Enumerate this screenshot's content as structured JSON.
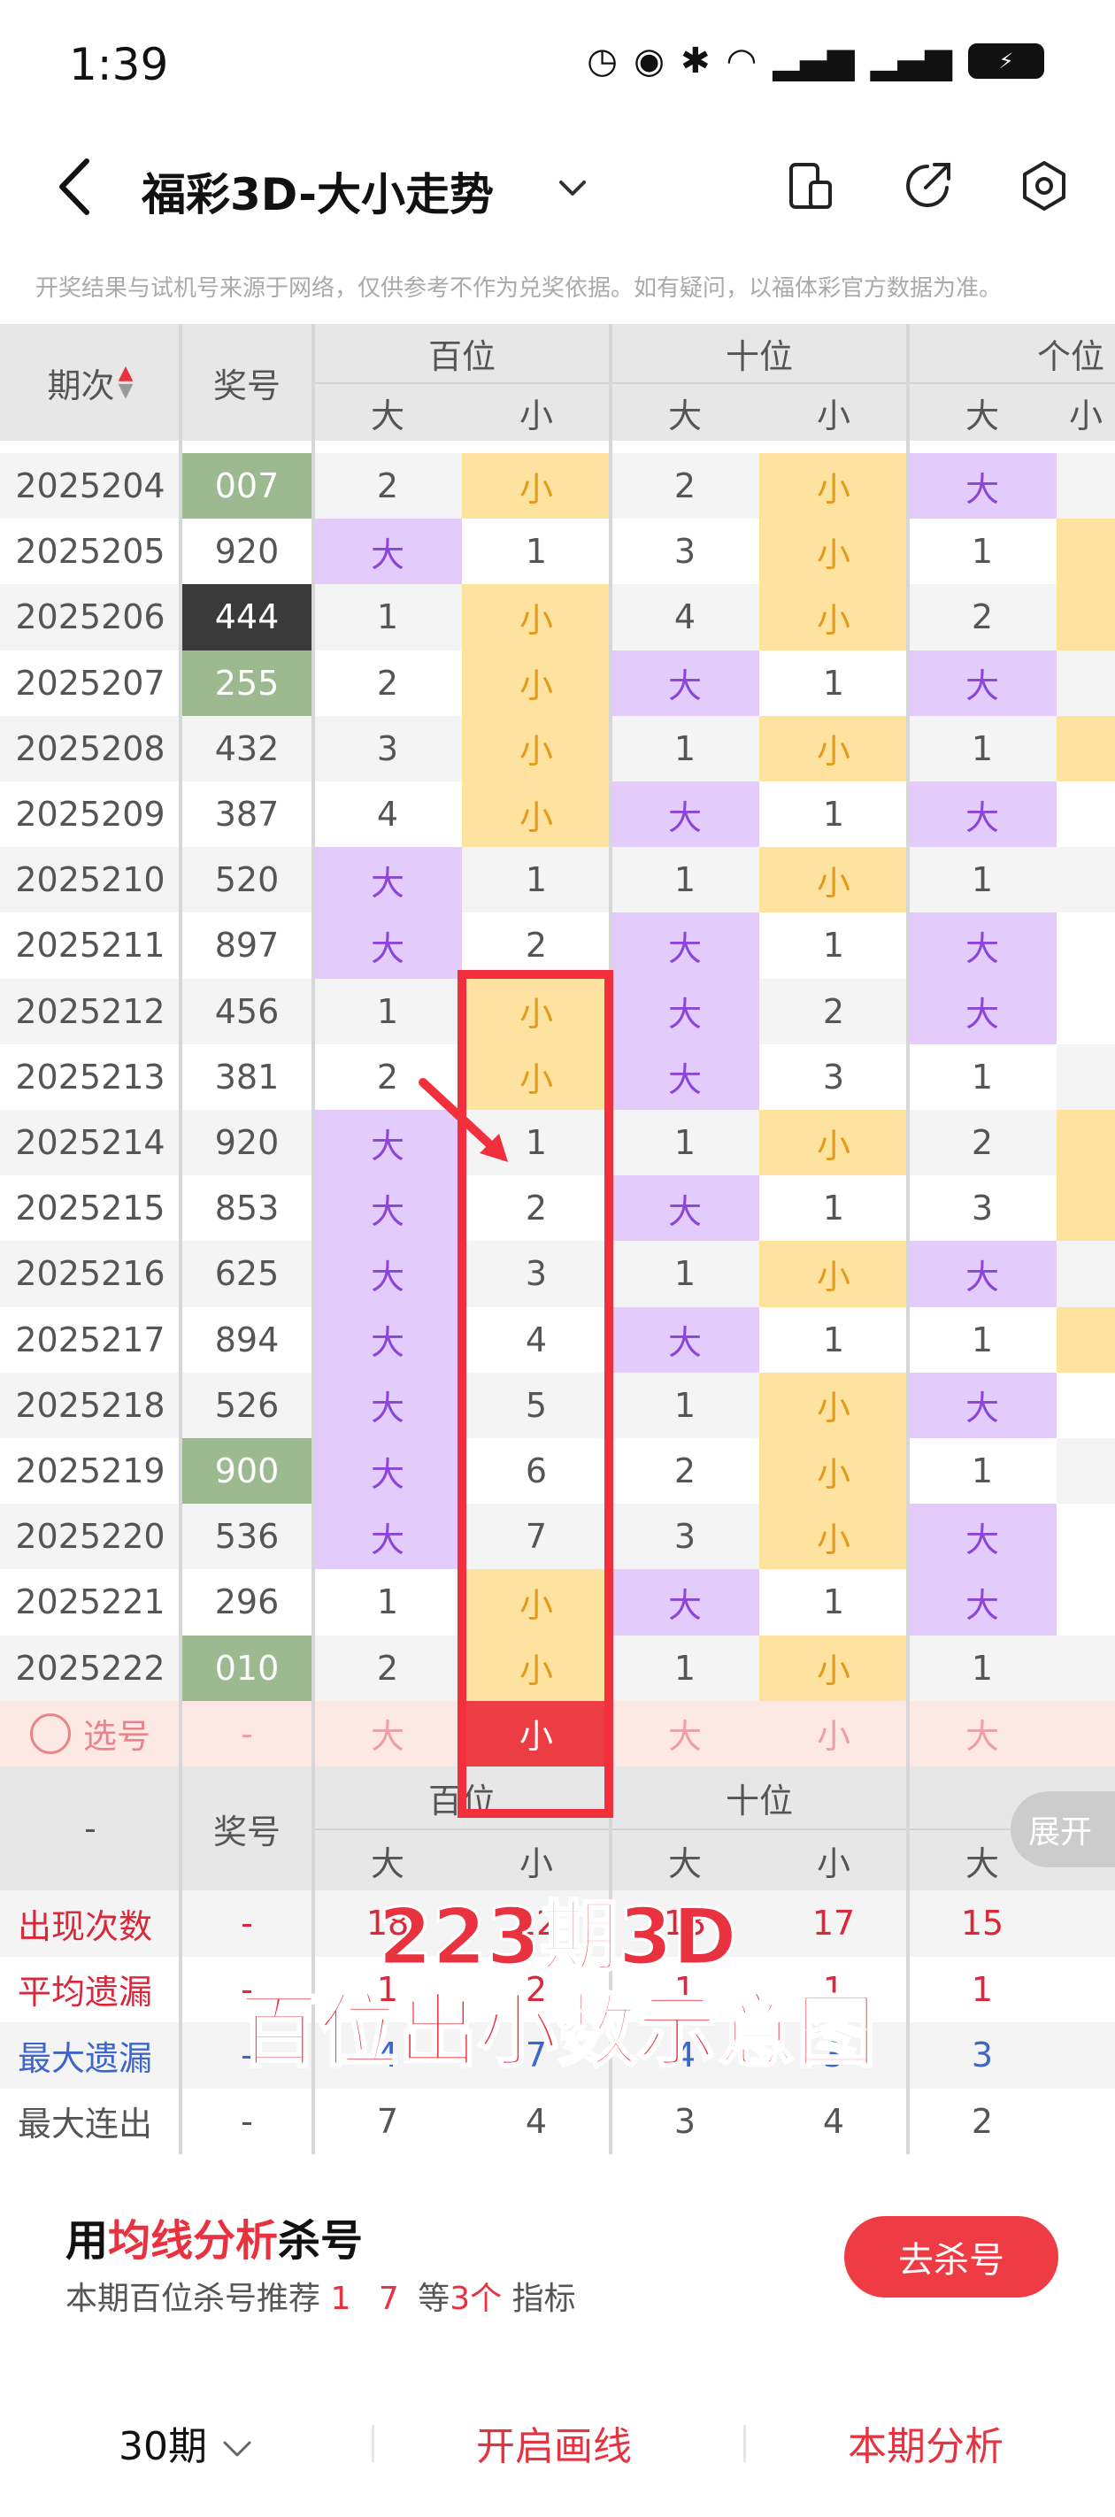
{
  "status": {
    "time": "1:39",
    "battery": "⚡"
  },
  "nav": {
    "title": "福彩3D-大小走势"
  },
  "notice": "开奖结果与试机号来源于网络，仅供参考不作为兑奖依据。如有疑问，以福体彩官方数据为准。",
  "table": {
    "col_period": "期次",
    "col_award": "奖号",
    "group_hundreds": "百位",
    "group_tens": "十位",
    "group_ones": "个位",
    "big": "大",
    "small": "小",
    "rows": [
      {
        "period": "2025204",
        "award": "007",
        "award_style": "green",
        "h_big": "2",
        "h_small": "小",
        "t_big": "2",
        "t_small": "小",
        "o_big": "大"
      },
      {
        "period": "2025205",
        "award": "920",
        "award_style": "none",
        "h_big": "大",
        "h_small": "1",
        "t_big": "3",
        "t_small": "小",
        "o_big": "1"
      },
      {
        "period": "2025206",
        "award": "444",
        "award_style": "dark",
        "h_big": "1",
        "h_small": "小",
        "t_big": "4",
        "t_small": "小",
        "o_big": "2"
      },
      {
        "period": "2025207",
        "award": "255",
        "award_style": "green",
        "h_big": "2",
        "h_small": "小",
        "t_big": "大",
        "t_small": "1",
        "o_big": "大"
      },
      {
        "period": "2025208",
        "award": "432",
        "award_style": "none",
        "h_big": "3",
        "h_small": "小",
        "t_big": "1",
        "t_small": "小",
        "o_big": "1"
      },
      {
        "period": "2025209",
        "award": "387",
        "award_style": "none",
        "h_big": "4",
        "h_small": "小",
        "t_big": "大",
        "t_small": "1",
        "o_big": "大"
      },
      {
        "period": "2025210",
        "award": "520",
        "award_style": "none",
        "h_big": "大",
        "h_small": "1",
        "t_big": "1",
        "t_small": "小",
        "o_big": "1"
      },
      {
        "period": "2025211",
        "award": "897",
        "award_style": "none",
        "h_big": "大",
        "h_small": "2",
        "t_big": "大",
        "t_small": "1",
        "o_big": "大"
      },
      {
        "period": "2025212",
        "award": "456",
        "award_style": "none",
        "h_big": "1",
        "h_small": "小",
        "t_big": "大",
        "t_small": "2",
        "o_big": "大"
      },
      {
        "period": "2025213",
        "award": "381",
        "award_style": "none",
        "h_big": "2",
        "h_small": "小",
        "t_big": "大",
        "t_small": "3",
        "o_big": "1"
      },
      {
        "period": "2025214",
        "award": "920",
        "award_style": "none",
        "h_big": "大",
        "h_small": "1",
        "t_big": "1",
        "t_small": "小",
        "o_big": "2"
      },
      {
        "period": "2025215",
        "award": "853",
        "award_style": "none",
        "h_big": "大",
        "h_small": "2",
        "t_big": "大",
        "t_small": "1",
        "o_big": "3"
      },
      {
        "period": "2025216",
        "award": "625",
        "award_style": "none",
        "h_big": "大",
        "h_small": "3",
        "t_big": "1",
        "t_small": "小",
        "o_big": "大"
      },
      {
        "period": "2025217",
        "award": "894",
        "award_style": "none",
        "h_big": "大",
        "h_small": "4",
        "t_big": "大",
        "t_small": "1",
        "o_big": "1"
      },
      {
        "period": "2025218",
        "award": "526",
        "award_style": "none",
        "h_big": "大",
        "h_small": "5",
        "t_big": "1",
        "t_small": "小",
        "o_big": "大"
      },
      {
        "period": "2025219",
        "award": "900",
        "award_style": "green",
        "h_big": "大",
        "h_small": "6",
        "t_big": "2",
        "t_small": "小",
        "o_big": "1"
      },
      {
        "period": "2025220",
        "award": "536",
        "award_style": "none",
        "h_big": "大",
        "h_small": "7",
        "t_big": "3",
        "t_small": "小",
        "o_big": "大"
      },
      {
        "period": "2025221",
        "award": "296",
        "award_style": "none",
        "h_big": "1",
        "h_small": "小",
        "t_big": "大",
        "t_small": "1",
        "o_big": "大"
      },
      {
        "period": "2025222",
        "award": "010",
        "award_style": "green",
        "h_big": "2",
        "h_small": "小",
        "t_big": "1",
        "t_small": "小",
        "o_big": "1"
      }
    ],
    "pick": {
      "label": "选号",
      "award": "-",
      "h_big": "大",
      "h_small": "小",
      "t_big": "大",
      "t_small": "小",
      "o_big": "大"
    }
  },
  "stats": {
    "dash": "-",
    "award_label": "奖号",
    "rows": [
      {
        "label": "出现次数",
        "color": "#d8283a",
        "award": "-",
        "h_big": "18",
        "h_small": "12",
        "t_big": "13",
        "t_small": "17",
        "o_big": "15"
      },
      {
        "label": "平均遗漏",
        "color": "#d8283a",
        "award": "-",
        "h_big": "1",
        "h_small": "2",
        "t_big": "1",
        "t_small": "1",
        "o_big": "1"
      },
      {
        "label": "最大遗漏",
        "color": "#3e66c8",
        "award": "-",
        "h_big": "4",
        "h_small": "7",
        "t_big": "4",
        "t_small": "3",
        "o_big": "3"
      },
      {
        "label": "最大连出",
        "color": "#555555",
        "award": "-",
        "h_big": "7",
        "h_small": "4",
        "t_big": "3",
        "t_small": "4",
        "o_big": "2"
      }
    ],
    "expand": "展开"
  },
  "overlay": {
    "line1": "223期3D",
    "line2": "百位出小数示意图"
  },
  "card": {
    "title_pre": "用",
    "title_hl": "均线分析",
    "title_post": "杀号",
    "sub_pre": "本期百位杀号推荐",
    "sub_nums": "1 7",
    "sub_mid": "等",
    "sub_cnt": "3个",
    "sub_post": "指标",
    "button": "去杀号"
  },
  "footer": {
    "periods": "30期",
    "draw": "开启画线",
    "analysis": "本期分析"
  }
}
